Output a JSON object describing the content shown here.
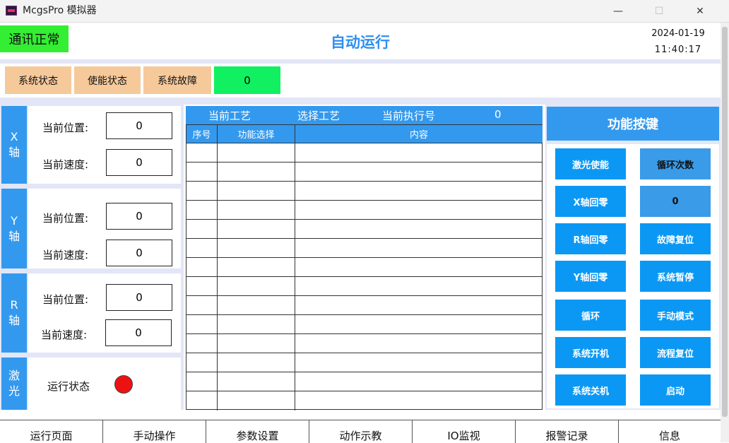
{
  "window": {
    "title": "McgsPro 模拟器",
    "minimize": "—",
    "maximize": "☐",
    "close": "✕"
  },
  "header": {
    "comm_status": "通讯正常",
    "title": "自动运行",
    "date": "2024-01-19",
    "time": "11:40:17"
  },
  "status_row": {
    "labels": [
      "系统状态",
      "使能状态",
      "系统故障"
    ],
    "fault_value": "0"
  },
  "axes": [
    {
      "name_top": "X",
      "name_bottom": "轴",
      "position_label": "当前位置:",
      "position_value": "0",
      "speed_label": "当前速度:",
      "speed_value": "0"
    },
    {
      "name_top": "Y",
      "name_bottom": "轴",
      "position_label": "当前位置:",
      "position_value": "0",
      "speed_label": "当前速度:",
      "speed_value": "0"
    },
    {
      "name_top": "R",
      "name_bottom": "轴",
      "position_label": "当前位置:",
      "position_value": "0",
      "speed_label": "当前速度:",
      "speed_value": "0"
    }
  ],
  "laser": {
    "name_top": "激",
    "name_bottom": "光",
    "status_label": "运行状态",
    "indicator_color": "#ee1111"
  },
  "process": {
    "current_label": "当前工艺",
    "select_label": "选择工艺",
    "exec_label": "当前执行号",
    "exec_value": "0",
    "columns": [
      "序号",
      "功能选择",
      "内容"
    ],
    "rows": 14
  },
  "functions": {
    "title": "功能按键",
    "buttons": [
      [
        "激光使能",
        "循环次数"
      ],
      [
        "X轴回零",
        "0"
      ],
      [
        "R轴回零",
        "故障复位"
      ],
      [
        "Y轴回零",
        "系统暂停"
      ],
      [
        "循环",
        "手动模式"
      ],
      [
        "系统开机",
        "流程复位"
      ],
      [
        "系统关机",
        "启动"
      ]
    ]
  },
  "nav": [
    "运行页面",
    "手动操作",
    "参数设置",
    "动作示教",
    "IO监视",
    "报警记录",
    "信息"
  ],
  "colors": {
    "accent": "#3399ee",
    "ok_green": "#33ee33",
    "status_orange": "#f6c99b"
  }
}
